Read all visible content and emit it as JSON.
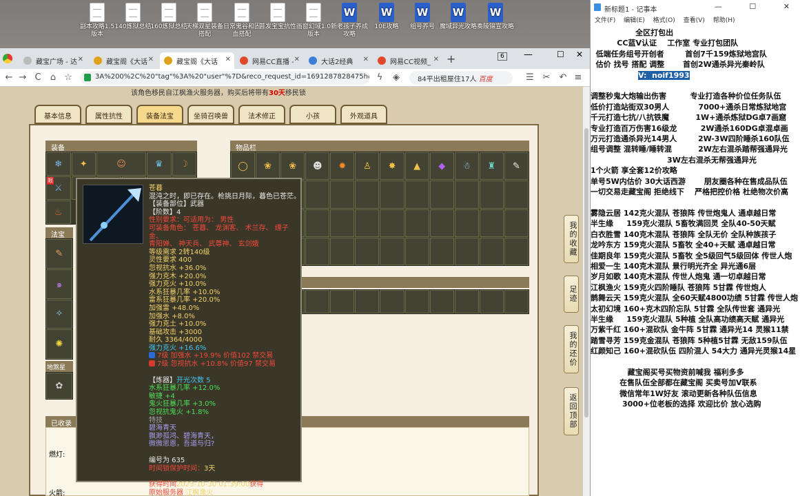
{
  "desktop": {
    "icons": [
      {
        "label": "副本攻略1.5版本",
        "type": "doc"
      },
      {
        "label": "140炼狱总结",
        "type": "doc"
      },
      {
        "label": "160炼狱总结",
        "type": "doc"
      },
      {
        "label": "天梯双星装备搭配",
        "type": "doc"
      },
      {
        "label": "日常鬼谷和固血搭配",
        "type": "doc"
      },
      {
        "label": "普发宝宝抗性",
        "type": "doc"
      },
      {
        "label": "画窗幻域1.0版本",
        "type": "doc"
      },
      {
        "label": "新老孩子养成攻略",
        "type": "word"
      },
      {
        "label": "10E攻略",
        "type": "word"
      },
      {
        "label": "组号养号",
        "type": "word"
      },
      {
        "label": "魔域异光攻略",
        "type": "word"
      },
      {
        "label": "奏陵锦宣攻略",
        "type": "word"
      }
    ]
  },
  "browser": {
    "tabs": [
      {
        "label": "藏宝广场 - 达",
        "color": "#888888"
      },
      {
        "label": "藏宝阁《大话",
        "color": "#e0a21a"
      },
      {
        "label": "藏宝阁《大话",
        "color": "#e0a21a",
        "active": true
      },
      {
        "label": "网易CC直播 - ",
        "color": "#e04a2a"
      },
      {
        "label": "大话2经典",
        "color": "#3a80d8"
      },
      {
        "label": "网易CC视频_",
        "color": "#e04a2a"
      }
    ],
    "tab_count": "6",
    "new_tab": "+",
    "url": "3A%200%2C%20\"tag\"%3A%20\"user\"%7D&reco_request_id=1691287828475hqMDD",
    "search_text": "84平出租屋住17人",
    "search_brand": "百度"
  },
  "game": {
    "notice_prefix": "该角色移民自江枫渔火服务器，购买后将带有",
    "notice_days": "30天",
    "notice_suffix": "移民锁",
    "tabs": [
      "基本信息",
      "属性抗性",
      "装备法宝",
      "坐骑召唤兽",
      "法术修正",
      "小孩",
      "外观道具"
    ],
    "sections": {
      "equip": "装备",
      "items": "物品栏",
      "fabao": "法宝",
      "lingbao": "地煞星",
      "collected": "已收录",
      "lantern": "燃灯:",
      "firecracker": "火箭:"
    },
    "equip_badge": "限",
    "items_row": [
      "◯",
      "❀",
      "❀",
      "☻",
      "✹",
      "♙",
      "✸",
      "▲",
      "◆",
      "☃",
      "♜",
      "✎"
    ],
    "side_buttons": [
      "我的收藏",
      "足迹",
      "我的还价",
      "返回顶部"
    ]
  },
  "tooltip": {
    "name": "苍暮",
    "desc": "混沌之时，即已存在。枪挑日月际，暮色已苍茫。",
    "slot": "【装备部位】武器",
    "tier_label": "【阶数】4",
    "gender": "性别要求：可适用为：  男性",
    "roles": "可装备角色：  苍暮、  龙渊客、  术兰存、  缥子金、",
    "roles2": "青阳婵、  神天兵、  武尊神、  玄剑娥",
    "level": "等级需求 2转140级",
    "stats": [
      "灵性要求 400",
      "忽视抗水 +36.0%",
      "强力克木 +20.0%",
      "强力克火 +10.0%",
      "水系狂暴几率 +10.0%",
      "雷系狂暴几率 +20.0%",
      "加强雷 +48.0%",
      "加强水 +8.0%",
      "强力克土 +10.0%",
      "基础攻击 +3000",
      "耐久 3364/4000",
      "强力克火 +16.6%"
    ],
    "gem1": "7级 加强水 +19.9% 价值102 禁交易",
    "gem2": "7级 忽视抗水 +10.8% 价值97 禁交易",
    "refine_label": "【炼器】",
    "refine_open": "开光次数 5",
    "refine_stats": [
      "水系狂暴几率 +12.0%",
      "敏捷 +4",
      "鬼火狂暴几率 +3.0%",
      "忽视抗鬼火 +1.8%"
    ],
    "special": "特技",
    "poem": [
      "碧海青天",
      "飘渺孤鸿、碧海青天，",
      "微微思恩，吾道与归?"
    ],
    "serial": "编号为 635",
    "protect_label": "时间锁保护时间：",
    "protect_value": "3天",
    "obtain_label": "获得时间",
    "obtain_value": "2023-10-30 01:39:00",
    "obtain_suffix": "获得",
    "server_label": "原始服务器",
    "server_value": "江枫渔火"
  },
  "notepad": {
    "title": "新标题1 - 记事本",
    "menu": [
      "文件(F)",
      "编辑(E)",
      "格式(O)",
      "查看(V)",
      "帮助(H)"
    ],
    "window_buttons": "— ☐ ✕",
    "lines": [
      {
        "t": "                 全区打包出"
      },
      {
        "t": "          CC蓝V认证    工作室 专业打包团队"
      },
      {
        "t": "  低端任务组号开创者        首创7千159炼狱地宫队"
      },
      {
        "t": "  估价 找号 搭配 调整       首创2W通杀异光秦岭队"
      },
      {
        "t": "                  ",
        "sel": "V:  noif1993"
      },
      {
        "t": ""
      },
      {
        "t": "调整秒鬼大炮输出伤害         专业打造各种价位任务队伍"
      },
      {
        "t": "低价打造站街双30男人           7000+通杀日常炼狱地宫"
      },
      {
        "t": "千元打造七抗/八抗铁魔          1W+通杀炼狱DG卓7画窟"
      },
      {
        "t": "专业打造百万伤害16级龙         2W通杀160DG卓混卓画"
      },
      {
        "t": "万元打造通杀异光14男人        2W-3W四阶睡杀160队伍"
      },
      {
        "t": "组号调整 混转睡/睡转混          2W左右混杀踏帮强通异光"
      },
      {
        "t": "                             3W左右混杀无帮强通异光"
      },
      {
        "t": "1个火箭 享全套12价攻略"
      },
      {
        "t": "单号5W内估价 30大话西游       朋友圈各种在售成品队伍"
      },
      {
        "t": "一切交易走藏宝阁 拒绝线下    严格把控价格 杜绝物次价高"
      },
      {
        "t": ""
      },
      {
        "t": "雾隐云居 142克火混队 苍狼阵 传世炮鬼人 通卓越日常"
      },
      {
        "t": "半生缘     159克火混队 5畜牧满回灵 全队40-50天赋"
      },
      {
        "t": "白衣胜雪 140克木混队 苍狼阵 全队无价 全队种族孩子"
      },
      {
        "t": "龙吟东方 159克火混队 5畜牧 全40+天赋 通卓越日常"
      },
      {
        "t": "佳期良年 159克火混队 5畜牧 全5级回气5级回体 传世人炮"
      },
      {
        "t": "相爱一生 140克木混队 景行明光齐全 异光通6层"
      },
      {
        "t": "岁月如歌 140克木混队 传世人炮鬼 通一切卓越日常"
      },
      {
        "t": "江枫渔火 159克火四阶睡队 苍狼阵 5甘霖 传世炮人"
      },
      {
        "t": "鹊舞云天 159克火混队 全60天赋4800功绩 5甘霖 传世人炮"
      },
      {
        "t": "太初幻境 160+克木四阶忘队 5甘霖 全队传世套 通异光"
      },
      {
        "t": "半生缘     159克火混队 5种植 全队高功绩高天赋 通异光"
      },
      {
        "t": "万紫千红 160+混砍队 金牛阵 5甘霖 通异光14 灵猴11禁"
      },
      {
        "t": "踏雪寻芳 159克金混队 苍狼阵 5种植5甘霖 无敌159队伍"
      },
      {
        "t": "红颜知己 160+混砍队伍 四阶混人 54大力 通异光灵猴14星"
      },
      {
        "t": ""
      },
      {
        "t": "              藏宝阁买号买物资前喊我 福利多多"
      },
      {
        "t": "           在售队伍全部都在藏宝阁 买卖号加V联系"
      },
      {
        "t": "           微信常年1W好友 滚动更新各种队伍信息"
      },
      {
        "t": "            3000+位老板的选择 欢迎比价 放心选购"
      }
    ]
  }
}
